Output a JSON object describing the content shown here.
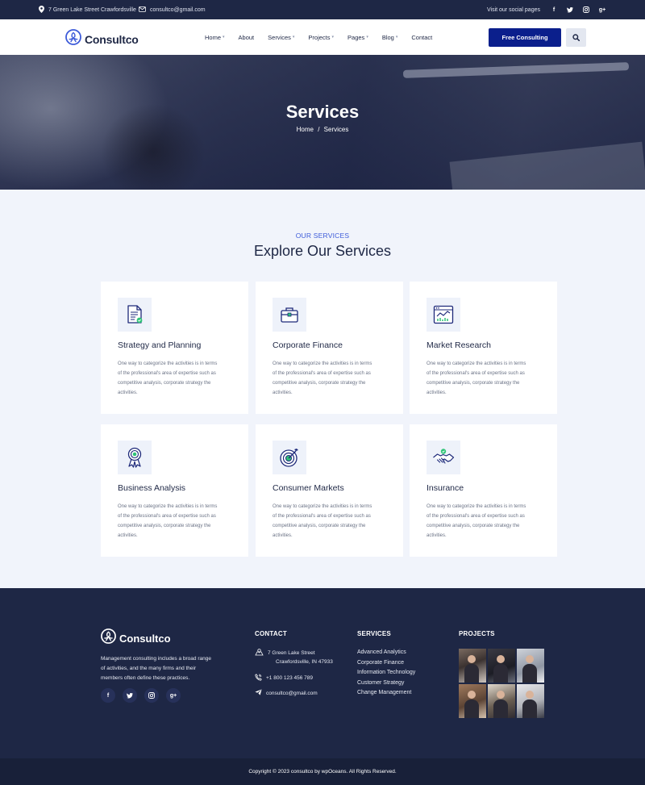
{
  "topbar": {
    "address": "7 Green Lake Street Crawfordsville",
    "email": "consultco@gmail.com",
    "social_label": "Visit our social pages",
    "social_icons": [
      "facebook-icon",
      "twitter-icon",
      "instagram-icon",
      "google-plus-icon"
    ]
  },
  "nav": {
    "logo": "Consultco",
    "items": [
      {
        "label": "Home",
        "dropdown": true
      },
      {
        "label": "About",
        "dropdown": false
      },
      {
        "label": "Services",
        "dropdown": true
      },
      {
        "label": "Projects",
        "dropdown": true
      },
      {
        "label": "Pages",
        "dropdown": true
      },
      {
        "label": "Blog",
        "dropdown": true
      },
      {
        "label": "Contact",
        "dropdown": false
      }
    ],
    "cta_label": "Free Consulting"
  },
  "hero": {
    "title": "Services",
    "crumb_home": "Home",
    "crumb_sep": "/",
    "crumb_current": "Services"
  },
  "services": {
    "eyebrow": "OUR SERVICES",
    "title": "Explore Our Services",
    "cards": [
      {
        "title": "Strategy and Planning",
        "icon": "document-check-icon",
        "desc": "One way to categorize the activities is in terms of the professional's area of expertise such as competitive analysis, corporate strategy the activities."
      },
      {
        "title": "Corporate Finance",
        "icon": "briefcase-icon",
        "desc": "One way to categorize the activities is in terms of the professional's area of expertise such as competitive analysis, corporate strategy the activities."
      },
      {
        "title": "Market Research",
        "icon": "analytics-chart-icon",
        "desc": "One way to categorize the activities is in terms of the professional's area of expertise such as competitive analysis, corporate strategy the activities."
      },
      {
        "title": "Business Analysis",
        "icon": "award-badge-icon",
        "desc": "One way to categorize the activities is in terms of the professional's area of expertise such as competitive analysis, corporate strategy the activities."
      },
      {
        "title": "Consumer Markets",
        "icon": "target-icon",
        "desc": "One way to categorize the activities is in terms of the professional's area of expertise such as competitive analysis, corporate strategy the activities."
      },
      {
        "title": "Insurance",
        "icon": "handshake-icon",
        "desc": "One way to categorize the activities is in terms of the professional's area of expertise such as competitive analysis, corporate strategy the activities."
      }
    ]
  },
  "footer": {
    "logo": "Consultco",
    "about": "Management consulting includes a broad range of activities, and the many firms and their members often define these practices.",
    "contact_heading": "CONTACT",
    "address_line1": "7 Green Lake Street",
    "address_line2": "Crawfordsville, IN 47933",
    "phone": "+1 800 123 456 789",
    "email": "consultco@gmail.com",
    "services_heading": "SERVICES",
    "services_links": [
      "Advanced Analytics",
      "Corporate Finance",
      "Information Technology",
      "Customer Strategy",
      "Change Management"
    ],
    "projects_heading": "PROJECTS",
    "project_photos": 6
  },
  "copyright": "Copyright © 2023 consultco by wpOceans. All Rights Reserved.",
  "colors": {
    "navy": "#1e2745",
    "accent_blue": "#0b1f8c",
    "eyebrow_blue": "#3d5bd9",
    "section_bg": "#f1f4fb",
    "icon_green": "#2fc477"
  }
}
